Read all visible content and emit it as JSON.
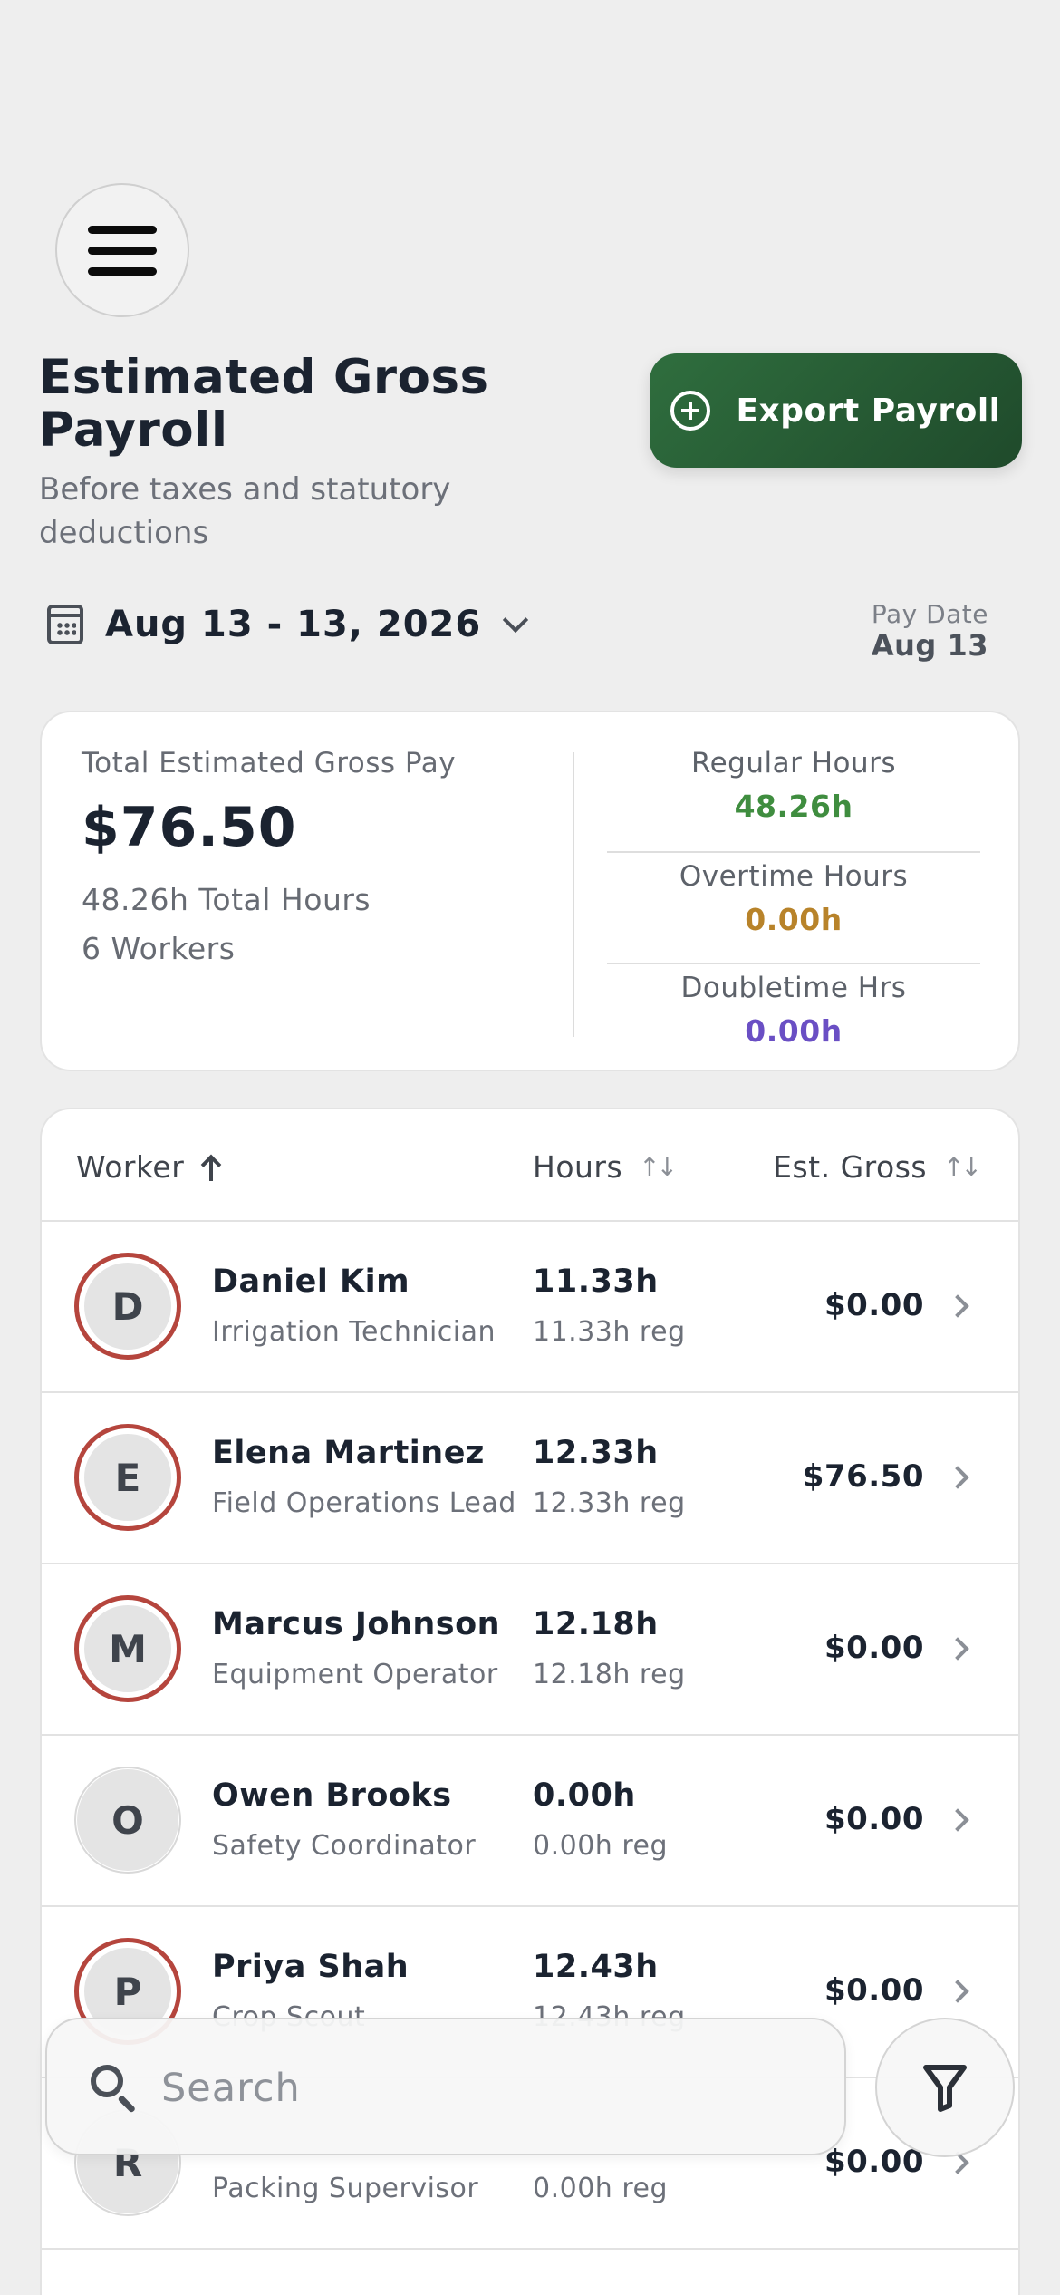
{
  "header": {
    "title": "Estimated Gross Payroll",
    "subtitle": "Before taxes and statutory deductions",
    "export_label": "Export Payroll"
  },
  "date_range": {
    "label": "Aug 13 - 13, 2026",
    "pay_date_label": "Pay Date",
    "pay_date_value": "Aug 13"
  },
  "summary": {
    "total_label": "Total Estimated Gross Pay",
    "total_amount": "$76.50",
    "total_hours": "48.26h Total Hours",
    "workers": "6 Workers",
    "stats": [
      {
        "label": "Regular Hours",
        "value": "48.26h",
        "color": "#3f8d3f"
      },
      {
        "label": "Overtime Hours",
        "value": "0.00h",
        "color": "#b8832a"
      },
      {
        "label": "Doubletime Hrs",
        "value": "0.00h",
        "color": "#6a4fc4"
      }
    ]
  },
  "table": {
    "columns": {
      "worker": "Worker",
      "hours": "Hours",
      "gross": "Est. Gross"
    },
    "rows": [
      {
        "initial": "D",
        "name": "Daniel Kim",
        "role": "Irrigation Technician",
        "hours": "11.33h",
        "reg": "11.33h reg",
        "gross": "$0.00",
        "ring": true
      },
      {
        "initial": "E",
        "name": "Elena Martinez",
        "role": "Field Operations Lead",
        "hours": "12.33h",
        "reg": "12.33h reg",
        "gross": "$76.50",
        "ring": true
      },
      {
        "initial": "M",
        "name": "Marcus Johnson",
        "role": "Equipment Operator",
        "hours": "12.18h",
        "reg": "12.18h reg",
        "gross": "$0.00",
        "ring": true
      },
      {
        "initial": "O",
        "name": "Owen Brooks",
        "role": "Safety Coordinator",
        "hours": "0.00h",
        "reg": "0.00h reg",
        "gross": "$0.00",
        "ring": false
      },
      {
        "initial": "P",
        "name": "Priya Shah",
        "role": "Crop Scout",
        "hours": "12.43h",
        "reg": "12.43h reg",
        "gross": "$0.00",
        "ring": true
      },
      {
        "initial": "R",
        "name": "",
        "role": "Packing Supervisor",
        "hours": "",
        "reg": "0.00h reg",
        "gross": "$0.00",
        "ring": false
      }
    ]
  },
  "search": {
    "placeholder": "Search"
  },
  "colors": {
    "accent": "#2b6439",
    "ring": "#b5453d"
  },
  "icons": [
    "menu-icon",
    "plus-circle-icon",
    "calendar-icon",
    "chevron-down-icon",
    "arrow-up-icon",
    "sort-icon",
    "chevron-right-icon",
    "search-icon",
    "filter-icon"
  ]
}
